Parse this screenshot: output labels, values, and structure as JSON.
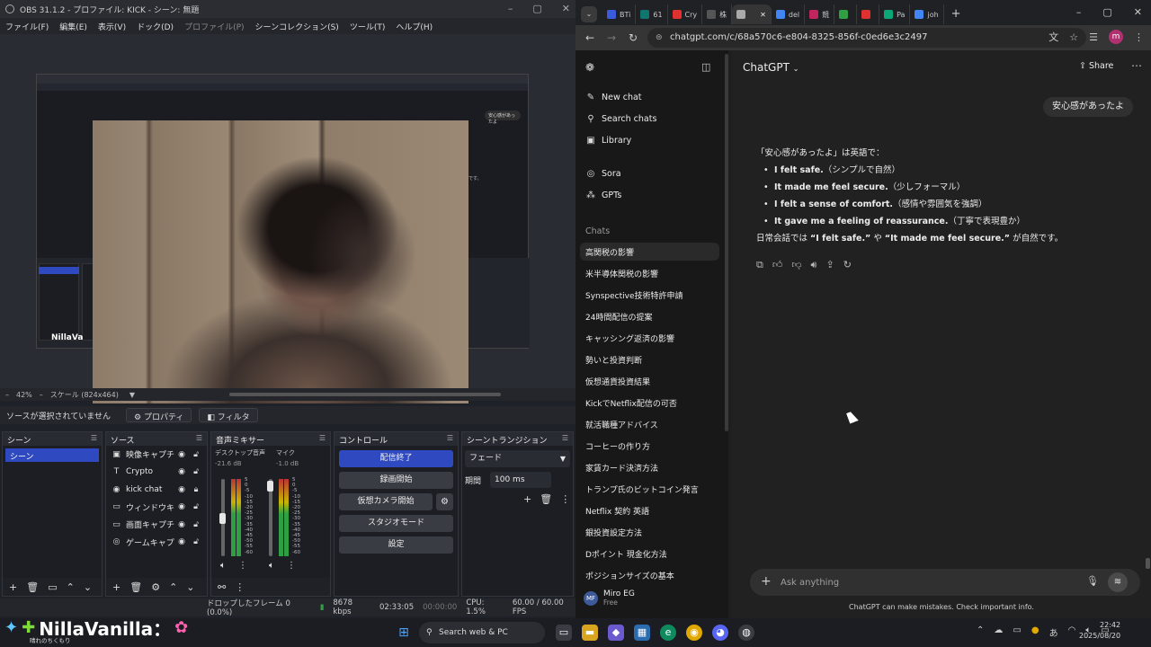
{
  "obs": {
    "title": "OBS 31.1.2 - プロファイル: KICK - シーン: 無題",
    "menu": [
      "ファイル(F)",
      "編集(E)",
      "表示(V)",
      "ドック(D)",
      "プロファイル(P)",
      "シーンコレクション(S)",
      "ツール(T)",
      "ヘルプ(H)"
    ],
    "zoom": "42%",
    "scale_label": "スケール (824x464)",
    "no_source": "ソースが選択されていません",
    "properties_btn": "プロパティ",
    "filters_btn": "フィルタ",
    "nested_bubble": "安心感があったよ",
    "nested_text": "です。",
    "overlay_name": "NillaVa",
    "docks": {
      "scenes": "シーン",
      "sources": "ソース",
      "mixer": "音声ミキサー",
      "controls": "コントロール",
      "transitions": "シーントランジション"
    },
    "scene_item": "シーン",
    "sources": [
      {
        "icon": "camera-icon",
        "glyph": "▣",
        "name": "映像キャプチャ"
      },
      {
        "icon": "text-icon",
        "glyph": "T",
        "name": "Crypto"
      },
      {
        "icon": "browser-icon",
        "glyph": "◉",
        "name": "kick chat"
      },
      {
        "icon": "window-icon",
        "glyph": "▭",
        "name": "ウィンドウキャプ"
      },
      {
        "icon": "monitor-icon",
        "glyph": "▭",
        "name": "画面キャプチャ"
      },
      {
        "icon": "gamepad-icon",
        "glyph": "◎",
        "name": "ゲームキャプチャ"
      }
    ],
    "mixer": [
      {
        "name": "デスクトップ音声",
        "db": "-21.6 dB"
      },
      {
        "name": "マイク",
        "db": "-1.0 dB"
      }
    ],
    "mixer_scale": [
      "5",
      "0",
      "-5",
      "-10",
      "-15",
      "-20",
      "-25",
      "-30",
      "-35",
      "-40",
      "-45",
      "-50",
      "-55",
      "-60"
    ],
    "controls": [
      "配信終了",
      "録画開始",
      "仮想カメラ開始",
      "スタジオモード",
      "設定"
    ],
    "transition": "フェード",
    "duration_label": "期間",
    "duration_value": "100 ms",
    "status": {
      "dropped": "ドロップしたフレーム 0 (0.0%)",
      "kbps": "8678 kbps",
      "stream_time": "02:33:05",
      "rec_time": "00:00:00",
      "cpu": "CPU: 1.5%",
      "fps": "60.00 / 60.00 FPS"
    }
  },
  "chrome": {
    "tabs": [
      {
        "label": "BTi",
        "color": "#3b5bdb"
      },
      {
        "label": "61",
        "color": "#0f766e"
      },
      {
        "label": "Cry",
        "color": "#e03131"
      },
      {
        "label": "株",
        "color": "#555555"
      },
      {
        "label": "",
        "color": "#aaaaaa"
      },
      {
        "label": "del",
        "color": "#4285f4"
      },
      {
        "label": "競",
        "color": "#c2255c"
      },
      {
        "label": "",
        "color": "#2f9e44"
      },
      {
        "label": "",
        "color": "#e03131"
      },
      {
        "label": "Pa",
        "color": "#0ca678"
      },
      {
        "label": "joh",
        "color": "#4285f4"
      }
    ],
    "url": "chatgpt.com/c/68a570c6-e804-8325-856f-c0ed6e3c2497"
  },
  "chatgpt": {
    "sidebar": {
      "new_chat": "New chat",
      "search_chats": "Search chats",
      "library": "Library",
      "sora": "Sora",
      "gpts": "GPTs",
      "chats_label": "Chats",
      "chats": [
        "高関税の影響",
        "米半導体関税の影響",
        "Synspective技術特許申請",
        "24時間配信の提案",
        "キャッシング返済の影響",
        "勢いと投資判断",
        "仮想通貨投資結果",
        "KickでNetflix配信の可否",
        "就活職種アドバイス",
        "コーヒーの作り方",
        "家賃カード決済方法",
        "トランプ氏のビットコイン発言",
        "Netflix 契約 英語",
        "銀投資設定方法",
        "Dポイント 現金化方法",
        "ポジションサイズの基本"
      ],
      "user_initials": "MF",
      "user_name": "Miro EG",
      "plan": "Free"
    },
    "header": {
      "title": "ChatGPT",
      "share": "Share"
    },
    "user_message": "安心感があったよ",
    "answer": {
      "intro": "「安心感があったよ」は英語で：",
      "items": [
        {
          "en": "I felt safe.",
          "note": "（シンプルで自然）"
        },
        {
          "en": "It made me feel secure.",
          "note": "（少しフォーマル）"
        },
        {
          "en": "I felt a sense of comfort.",
          "note": "（感情や雰囲気を強調）"
        },
        {
          "en": "It gave me a feeling of reassurance.",
          "note": "（丁寧で表現豊か）"
        }
      ],
      "outro_pre": "日常会話では ",
      "outro_a": "“I felt safe.”",
      "outro_mid": " や ",
      "outro_b": "“It made me feel secure.”",
      "outro_post": " が自然です。"
    },
    "composer_placeholder": "Ask anything",
    "disclaimer": "ChatGPT can make mistakes. Check important info."
  },
  "taskbar": {
    "overlay_name": "NillaVanilla：",
    "overlay_sub": "晴れのちくもり",
    "search": "Search web & PC",
    "time": "22:42",
    "date": "2025/08/20"
  }
}
